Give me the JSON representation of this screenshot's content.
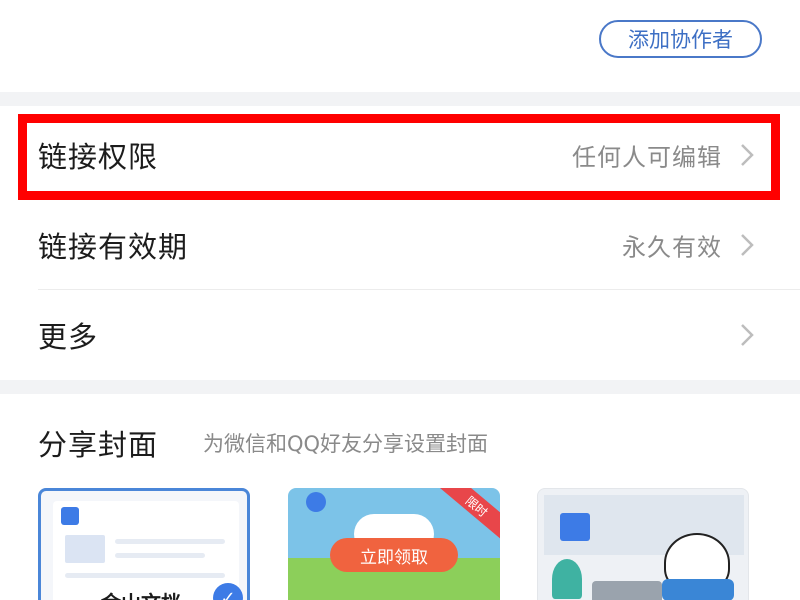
{
  "header": {
    "add_collaborator_label": "添加协作者"
  },
  "settings": {
    "rows": [
      {
        "label": "链接权限",
        "value": "任何人可编辑"
      },
      {
        "label": "链接有效期",
        "value": "永久有效"
      },
      {
        "label": "更多",
        "value": ""
      }
    ]
  },
  "cover": {
    "title": "分享封面",
    "subtitle": "为微信和QQ好友分享设置封面",
    "cards": [
      {
        "brand_text": "金山文档",
        "selected": true
      },
      {
        "button_label": "立即领取",
        "ribbon_label": "限时"
      },
      {}
    ]
  },
  "colors": {
    "accent": "#3d7be6",
    "highlight": "#ff0000",
    "section_gap": "#f2f3f5"
  }
}
